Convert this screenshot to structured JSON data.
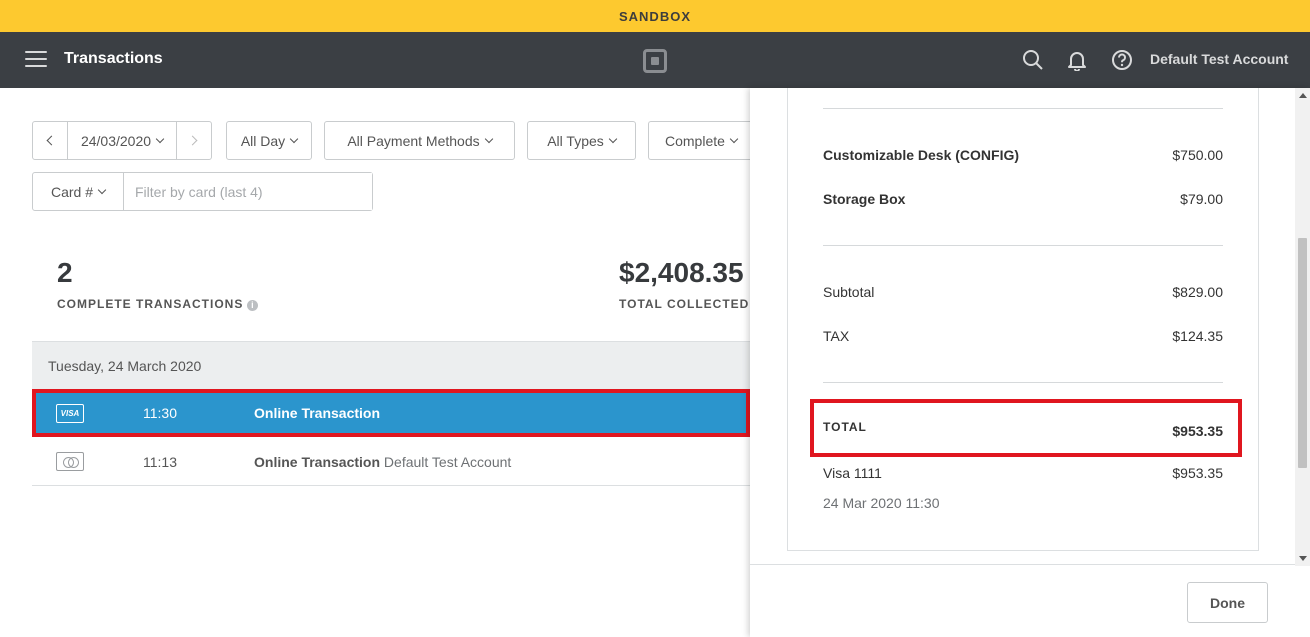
{
  "banner": "SANDBOX",
  "topnav": {
    "title": "Transactions",
    "account": "Default Test Account"
  },
  "filters": {
    "date": "24/03/2020",
    "time_range": "All Day",
    "payment_methods": "All Payment Methods",
    "types": "All Types",
    "status": "Complete",
    "card_select": "Card #",
    "card_placeholder": "Filter by card (last 4)"
  },
  "stats": {
    "count": "2",
    "count_label": "COMPLETE TRANSACTIONS",
    "total": "$2,408.35",
    "total_label": "TOTAL COLLECTED"
  },
  "day_header": "Tuesday, 24 March 2020",
  "transactions": [
    {
      "card": "VISA",
      "time": "11:30",
      "desc": "Online Transaction",
      "sub": ""
    },
    {
      "card": "mastercard",
      "time": "11:13",
      "desc": "Online Transaction",
      "sub": "Default Test Account"
    }
  ],
  "receipt": {
    "items": [
      {
        "name": "Customizable Desk (CONFIG)",
        "price": "$750.00"
      },
      {
        "name": "Storage Box",
        "price": "$79.00"
      }
    ],
    "subtotal_label": "Subtotal",
    "subtotal": "$829.00",
    "tax_label": "TAX",
    "tax": "$124.35",
    "total_label": "TOTAL",
    "total": "$953.35",
    "payment_label": "Visa 1111",
    "payment_amount": "$953.35",
    "datetime": "24 Mar 2020 11:30"
  },
  "done_label": "Done",
  "colors": {
    "banner": "#fdc92f",
    "nav": "#3b3f44",
    "selected_row": "#2b95cd",
    "highlight": "#e0161f"
  }
}
